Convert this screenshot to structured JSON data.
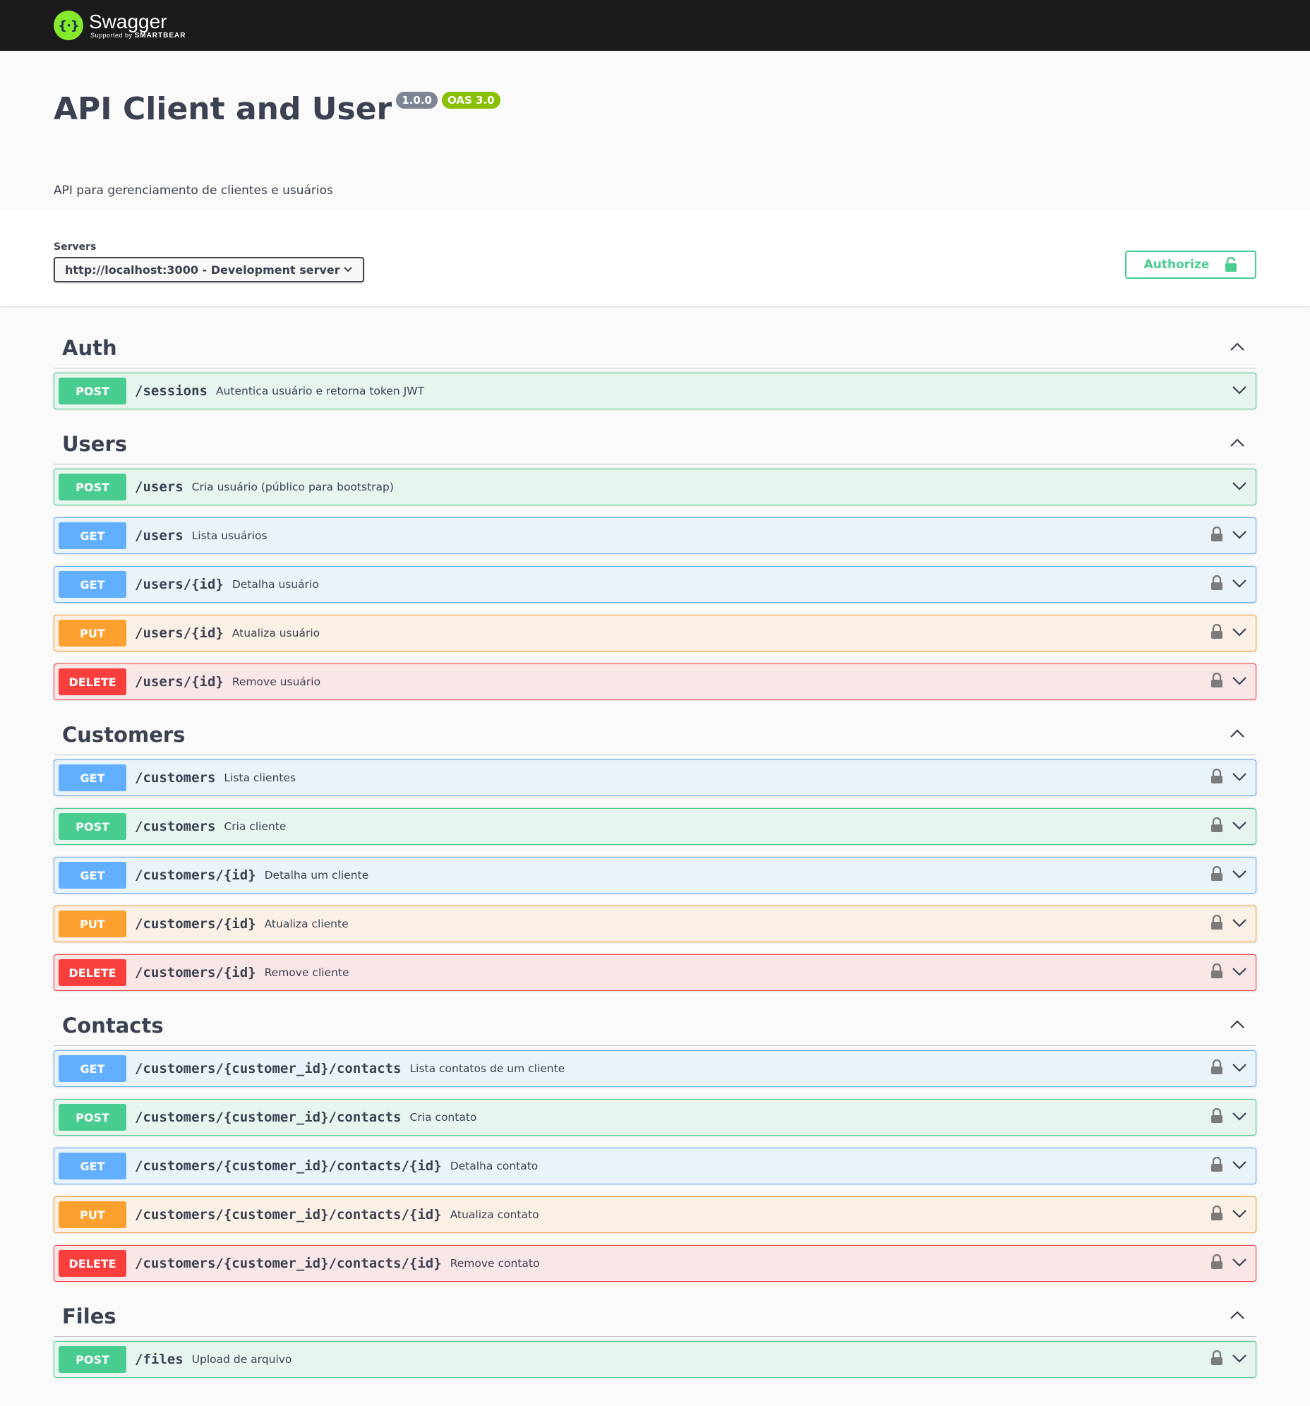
{
  "topbar": {
    "brand_name": "Swagger",
    "brand_sub_prefix": "Supported by",
    "brand_sub_company": "SMARTBEAR"
  },
  "info": {
    "title": "API Client and User",
    "version": "1.0.0",
    "oas": "OAS 3.0",
    "description": "API para gerenciamento de clientes e usuários"
  },
  "servers": {
    "label": "Servers",
    "selected": "http://localhost:3000 - Development server"
  },
  "authorize": {
    "label": "Authorize"
  },
  "colors": {
    "post": "#49cc90",
    "get": "#61affe",
    "put": "#fca130",
    "delete": "#f93e3e",
    "topbar": "#1b1b1b"
  },
  "tags": [
    {
      "name": "Auth",
      "ops": [
        {
          "method": "POST",
          "path": "/sessions",
          "summary": "Autentica usuário e retorna token JWT",
          "locked": false
        }
      ]
    },
    {
      "name": "Users",
      "ops": [
        {
          "method": "POST",
          "path": "/users",
          "summary": "Cria usuário (público para bootstrap)",
          "locked": false
        },
        {
          "method": "GET",
          "path": "/users",
          "summary": "Lista usuários",
          "locked": true
        },
        {
          "method": "GET",
          "path": "/users/{id}",
          "summary": "Detalha usuário",
          "locked": true
        },
        {
          "method": "PUT",
          "path": "/users/{id}",
          "summary": "Atualiza usuário",
          "locked": true
        },
        {
          "method": "DELETE",
          "path": "/users/{id}",
          "summary": "Remove usuário",
          "locked": true
        }
      ]
    },
    {
      "name": "Customers",
      "ops": [
        {
          "method": "GET",
          "path": "/customers",
          "summary": "Lista clientes",
          "locked": true
        },
        {
          "method": "POST",
          "path": "/customers",
          "summary": "Cria cliente",
          "locked": true
        },
        {
          "method": "GET",
          "path": "/customers/{id}",
          "summary": "Detalha um cliente",
          "locked": true
        },
        {
          "method": "PUT",
          "path": "/customers/{id}",
          "summary": "Atualiza cliente",
          "locked": true
        },
        {
          "method": "DELETE",
          "path": "/customers/{id}",
          "summary": "Remove cliente",
          "locked": true
        }
      ]
    },
    {
      "name": "Contacts",
      "ops": [
        {
          "method": "GET",
          "path": "/customers/{customer_id}/contacts",
          "summary": "Lista contatos de um cliente",
          "locked": true
        },
        {
          "method": "POST",
          "path": "/customers/{customer_id}/contacts",
          "summary": "Cria contato",
          "locked": true
        },
        {
          "method": "GET",
          "path": "/customers/{customer_id}/contacts/{id}",
          "summary": "Detalha contato",
          "locked": true
        },
        {
          "method": "PUT",
          "path": "/customers/{customer_id}/contacts/{id}",
          "summary": "Atualiza contato",
          "locked": true
        },
        {
          "method": "DELETE",
          "path": "/customers/{customer_id}/contacts/{id}",
          "summary": "Remove contato",
          "locked": true
        }
      ]
    },
    {
      "name": "Files",
      "ops": [
        {
          "method": "POST",
          "path": "/files",
          "summary": "Upload de arquivo",
          "locked": true
        }
      ]
    }
  ]
}
